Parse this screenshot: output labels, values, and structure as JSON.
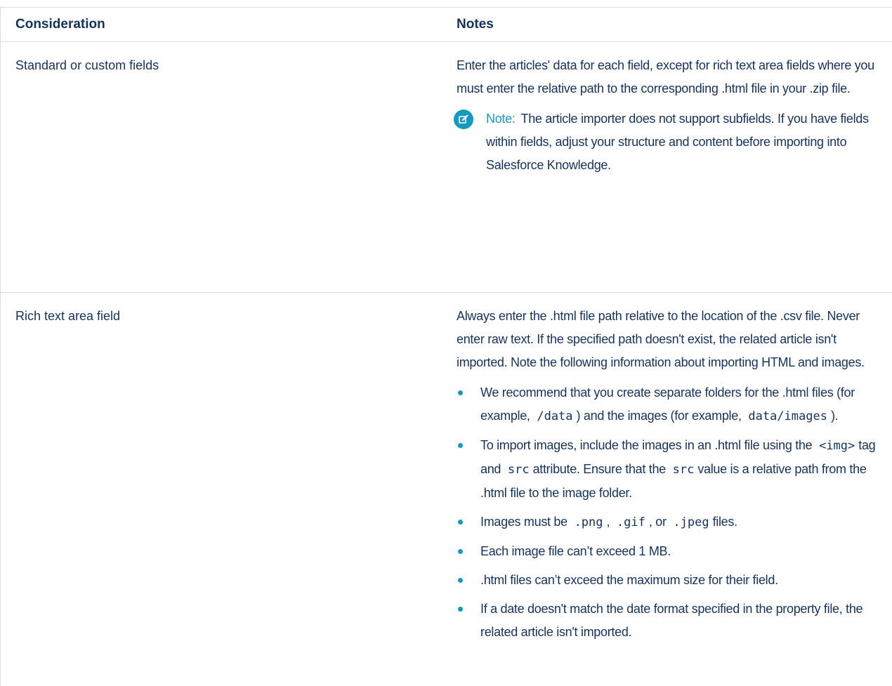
{
  "header": {
    "consideration": "Consideration",
    "notes": "Notes"
  },
  "rows": [
    {
      "consideration": "Standard or custom fields",
      "notes_text": "Enter the articles' data for each field, except for rich text area fields where you must enter the relative path to the corresponding .html file in your .zip file.",
      "note": {
        "label": "Note:",
        "text": "The article importer does not support subfields. If you have fields within fields, adjust your structure and content before importing into Salesforce Knowledge."
      }
    },
    {
      "consideration": "Rich text area field",
      "notes_text": "Always enter the .html file path relative to the location of the .csv file. Never enter raw text. If the specified path doesn't exist, the related article isn't imported. Note the following information about importing HTML and images.",
      "bullets": {
        "b1": {
          "t1": "We recommend that you create separate folders for the .html files (for example,",
          "c1": "/data",
          "t2": ") and the images (for example,",
          "c2": "data/images",
          "t3": ")."
        },
        "b2": {
          "t1": "To import images, include the images in an .html file using the",
          "c1": "<img>",
          "t2": "tag and",
          "c2": "src",
          "t3": "attribute. Ensure that the",
          "c3": "src",
          "t4": "value is a relative path from the .html file to the image folder."
        },
        "b3": {
          "t1": "Images must be",
          "c1": ".png",
          "t2": ",",
          "c2": ".gif",
          "t3": ", or",
          "c3": ".jpeg",
          "t4": "files."
        },
        "b4": {
          "t1": "Each image file can’t exceed 1 MB."
        },
        "b5": {
          "t1": ".html files can’t exceed the maximum size for their field."
        },
        "b6": {
          "t1": "If a date doesn't match the date format specified in the property file, the related article isn't imported."
        }
      }
    }
  ],
  "colors": {
    "text": "#16325c",
    "accent": "#1798c1",
    "border": "#d8dde6"
  },
  "icons": {
    "note": "edit-note-icon",
    "bullet": "bullet-dot-icon"
  }
}
